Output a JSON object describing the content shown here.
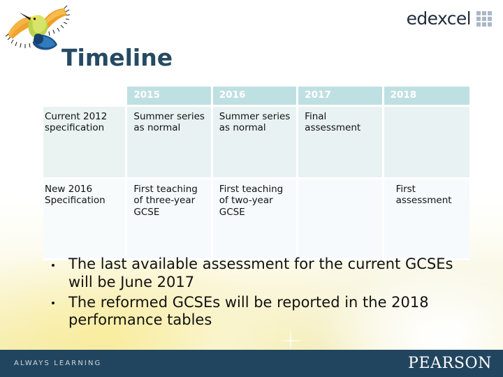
{
  "brand": {
    "edexcel_word": "edexcel",
    "bird_logo_name": "bee-eater-bird-logo",
    "accent_navy": "#22455f",
    "accent_title": "#264a63",
    "header_teal": "#bfe0e2",
    "row_a_bg": "#e9f2f2",
    "row_b_bg": "#f6fafc"
  },
  "header": {
    "title": "Timeline"
  },
  "table": {
    "row_header_blank": "",
    "columns": [
      "2015",
      "2016",
      "2017",
      "2018"
    ],
    "rows": [
      {
        "label": "Current 2012 specification",
        "cells": [
          "Summer series as normal",
          "Summer series as normal",
          "Final assessment",
          ""
        ]
      },
      {
        "label": "New 2016 Specification",
        "cells": [
          "First teaching of three-year GCSE",
          "First teaching of two-year GCSE",
          "",
          "First assessment"
        ]
      }
    ]
  },
  "bullets": [
    "The last available assessment for the current GCSEs will be June 2017",
    "The reformed GCSEs will be reported in the 2018 performance tables"
  ],
  "footer": {
    "tagline": "ALWAYS LEARNING",
    "brand": "PEARSON"
  }
}
